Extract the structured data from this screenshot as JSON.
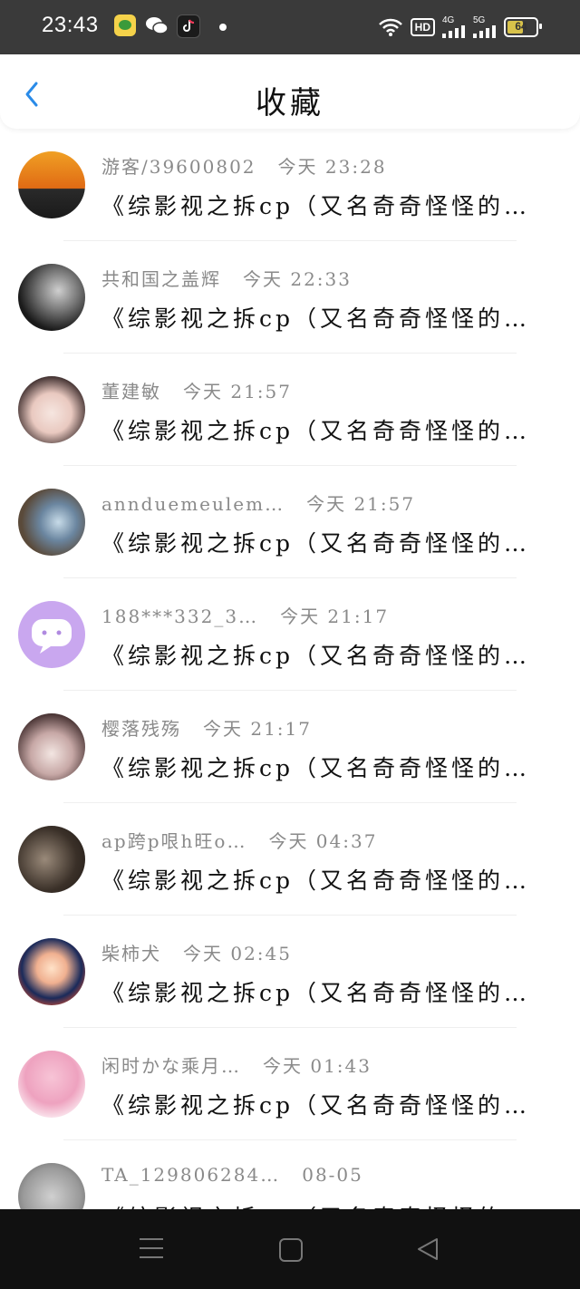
{
  "status_bar": {
    "time": "23:43",
    "hd": "HD",
    "net1": "4G",
    "net2": "5G",
    "battery": "64",
    "battery_level_percent": 64,
    "icons": [
      "wifi-icon",
      "signal-icon"
    ]
  },
  "header": {
    "title": "收藏",
    "back_icon": "chevron-left-icon",
    "accent": "#2a8be8"
  },
  "items": [
    {
      "name": "游客/39600802",
      "time": "今天 23:28",
      "post": "《综影视之拆cp（又名奇奇怪怪的…"
    },
    {
      "name": "共和国之盖辉",
      "time": "今天 22:33",
      "post": "《综影视之拆cp（又名奇奇怪怪的…"
    },
    {
      "name": "董建敏",
      "time": "今天 21:57",
      "post": "《综影视之拆cp（又名奇奇怪怪的…"
    },
    {
      "name": "annduemeulem…",
      "time": "今天 21:57",
      "post": "《综影视之拆cp（又名奇奇怪怪的…"
    },
    {
      "name": "188***332_3…",
      "time": "今天 21:17",
      "post": "《综影视之拆cp（又名奇奇怪怪的…"
    },
    {
      "name": "樱落残殇",
      "time": "今天 21:17",
      "post": "《综影视之拆cp（又名奇奇怪怪的…"
    },
    {
      "name": "ap跨p哏h旺o…",
      "time": "今天 04:37",
      "post": "《综影视之拆cp（又名奇奇怪怪的…"
    },
    {
      "name": "柴柿犬",
      "time": "今天 02:45",
      "post": "《综影视之拆cp（又名奇奇怪怪的…"
    },
    {
      "name": "闲时かな乘月…",
      "time": "今天 01:43",
      "post": "《综影视之拆cp（又名奇奇怪怪的…"
    },
    {
      "name": "TA_129806284…",
      "time": "08-05",
      "post": "《综影视之拆cp（又名奇奇怪怪的…"
    }
  ],
  "nav": {
    "icons": [
      "menu-icon",
      "home-square-icon",
      "back-triangle-icon"
    ]
  }
}
